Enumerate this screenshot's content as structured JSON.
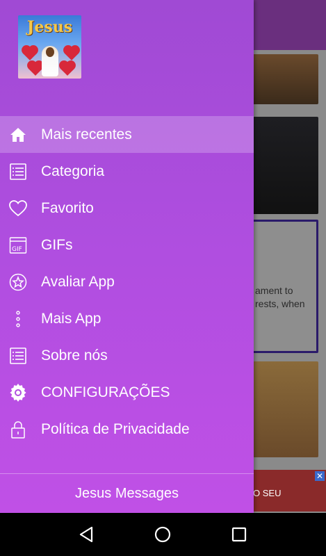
{
  "background": {
    "card_text_lines": [
      "ament to",
      "rests, when"
    ],
    "ad_text": "O SEU",
    "ad_close": "✕"
  },
  "drawer": {
    "logo_title": "Jesus",
    "menu": [
      {
        "label": "Mais recentes",
        "icon": "home-icon",
        "active": true
      },
      {
        "label": "Categoria",
        "icon": "list-icon"
      },
      {
        "label": "Favorito",
        "icon": "heart-icon"
      },
      {
        "label": "GIFs",
        "icon": "gif-icon"
      },
      {
        "label": "Avaliar App",
        "icon": "star-icon"
      },
      {
        "label": "Mais App",
        "icon": "more-vertical-icon"
      },
      {
        "label": "Sobre nós",
        "icon": "list-icon"
      },
      {
        "label": "CONFIGURAÇÕES",
        "icon": "settings-icon"
      },
      {
        "label": "Política de Privacidade",
        "icon": "lock-icon"
      }
    ],
    "footer": "Jesus Messages"
  },
  "navbar": {
    "back": "back-icon",
    "home": "home-circle-icon",
    "recents": "recents-icon"
  }
}
